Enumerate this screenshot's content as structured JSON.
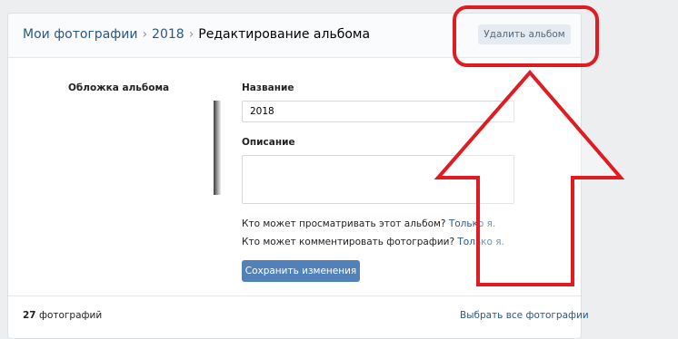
{
  "breadcrumb": {
    "items": [
      {
        "label": "Мои фотографии"
      },
      {
        "label": "2018"
      }
    ],
    "separator": "›",
    "current": "Редактирование альбома"
  },
  "header": {
    "delete_label": "Удалить альбом"
  },
  "cover": {
    "label": "Обложка альбома"
  },
  "form": {
    "name_label": "Название",
    "name_value": "2018",
    "description_label": "Описание",
    "description_value": "",
    "view_question": "Кто может просматривать этот альбом?",
    "view_value": "Только я.",
    "comment_question": "Кто может комментировать фотографии?",
    "comment_value": "Только я.",
    "save_label": "Сохранить изменения"
  },
  "footer": {
    "count_number": "27",
    "count_label": "фотографий",
    "select_all_label": "Выбрать все фотографии"
  },
  "annotation": {
    "color": "#e01b22",
    "shapes": [
      "rounded-rectangle",
      "up-arrow"
    ]
  }
}
